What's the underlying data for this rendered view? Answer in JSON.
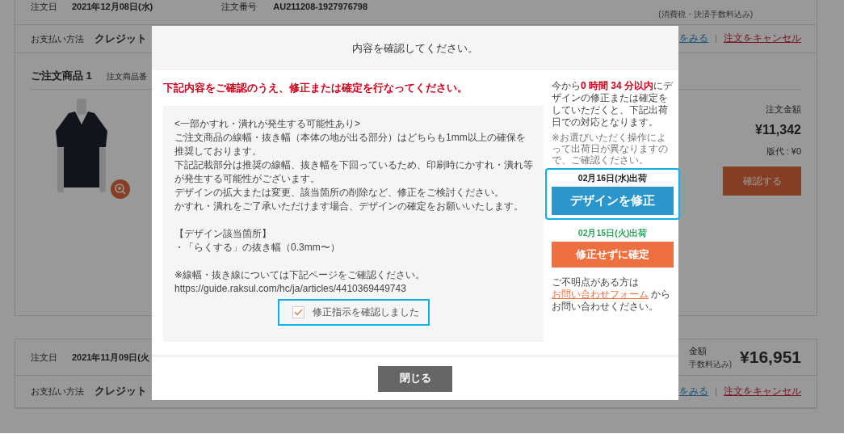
{
  "orders": [
    {
      "order_date_label": "注文日",
      "order_date": "2021年12月08日(水)",
      "order_number_label": "注文番号",
      "order_number": "AU211208-1927976798",
      "total_note": "(消費税・決済手数料込み)",
      "payment_label": "お支払い方法",
      "payment_method": "クレジット",
      "details_link": "をみる",
      "separator": "|",
      "cancel_link": "注文をキャンセル",
      "item_title": "ご注文商品 1",
      "item_number_label": "注文商品番",
      "amount_label": "注文金額",
      "amount": "¥11,342",
      "plate_fee": "版代 : ¥0",
      "confirm_button": "確認する"
    },
    {
      "order_date_label": "注文日",
      "order_date": "2021年11月09日(火",
      "total_label": "金額",
      "total": "¥16,951",
      "total_note": "手数料込み)",
      "payment_label": "お支払い方法",
      "payment_method": "クレジット",
      "details_link": "をみる",
      "separator": "|",
      "cancel_link": "注文をキャンセル"
    }
  ],
  "dialog": {
    "title": "内容を確認してください。",
    "heading": "下記内容をご確認のうえ、修正または確定を行なってください。",
    "notice": [
      [
        "<一部かすれ・潰れが発生する可能性あり>",
        "ご注文商品の線幅・抜き幅（本体の地が出る部分）はどちらも1mm以上の確保を推奨しております。",
        "下記記載部分は推奨の線幅、抜き幅を下回っているため、印刷時にかすれ・潰れ等が発生する可能性がございます。",
        "デザインの拡大または変更、該当箇所の削除など、修正をご検討ください。",
        "かすれ・潰れをご了承いただけます場合、デザインの確定をお願いいたします。"
      ],
      [
        "【デザイン該当箇所】",
        "・「らくする」の抜き幅（0.3mm〜）"
      ],
      [
        "※線幅・抜き線については下記ページをご確認ください。",
        "https://guide.raksul.com/hc/ja/articles/4410369449743"
      ]
    ],
    "confirm_checkbox": {
      "label": "修正指示を確認しました",
      "checked": true
    },
    "intro": "今から**0 時間 34 分以内**にデザインの修正または確定をしていただくと、下記出荷日での対応となります。",
    "note": "※お選びいただく操作によって出荷日が異なりますので、ご確認ください。",
    "options": [
      {
        "kind": "revise",
        "ship_date": "02月16日(水)出荷",
        "button": "デザインを修正",
        "selected": true
      },
      {
        "kind": "confirm",
        "ship_date": "02月15日(火)出荷",
        "button": "修正せずに確定",
        "selected": false
      }
    ],
    "contact": {
      "before": "ご不明点がある方は",
      "link": "お問い合わせフォーム",
      "after": "からお問い合わせください。"
    },
    "close_button": "閉じる"
  }
}
